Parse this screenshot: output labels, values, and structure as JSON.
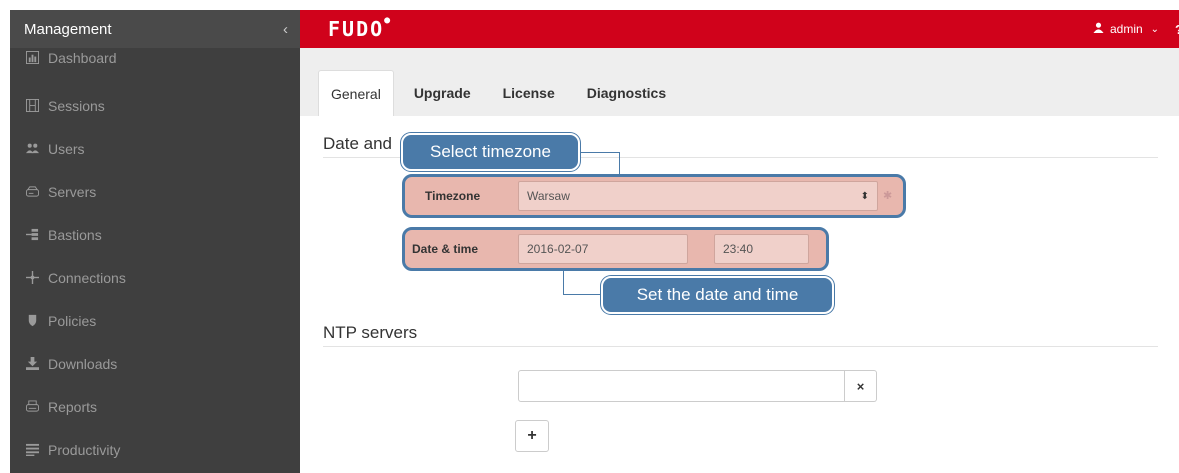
{
  "sidebar": {
    "title": "Management",
    "collapse_icon": "‹",
    "items": [
      {
        "label": "Dashboard",
        "icon": "bar-chart-icon"
      },
      {
        "label": "Sessions",
        "icon": "film-icon"
      },
      {
        "label": "Users",
        "icon": "users-icon"
      },
      {
        "label": "Servers",
        "icon": "server-icon"
      },
      {
        "label": "Bastions",
        "icon": "bastion-icon"
      },
      {
        "label": "Connections",
        "icon": "connections-icon"
      },
      {
        "label": "Policies",
        "icon": "shield-icon"
      },
      {
        "label": "Downloads",
        "icon": "download-icon"
      },
      {
        "label": "Reports",
        "icon": "printer-icon"
      },
      {
        "label": "Productivity",
        "icon": "list-icon"
      }
    ]
  },
  "topbar": {
    "logo": "FUDO",
    "user": "admin",
    "help": "?",
    "color": "#d0021b"
  },
  "tabs": [
    {
      "label": "General",
      "active": true
    },
    {
      "label": "Upgrade",
      "active": false
    },
    {
      "label": "License",
      "active": false
    },
    {
      "label": "Diagnostics",
      "active": false
    }
  ],
  "date_section": {
    "title": "Date and",
    "timezone_label": "Timezone",
    "timezone_value": "Warsaw",
    "datetime_label": "Date & time",
    "date_value": "2016-02-07",
    "time_value": "23:40"
  },
  "callouts": {
    "timezone": "Select timezone",
    "datetime": "Set the date and time"
  },
  "ntp_section": {
    "title": "NTP servers",
    "input_value": "",
    "remove_icon": "×",
    "add_icon": "+"
  }
}
